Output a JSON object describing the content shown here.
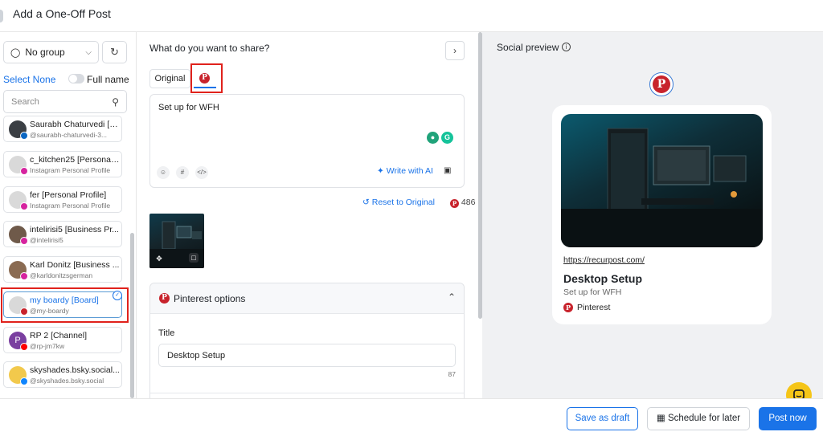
{
  "header": {
    "title": "Add a One-Off Post"
  },
  "sidebar": {
    "group_label": "No group",
    "select_none": "Select None",
    "full_name_label": "Full name",
    "search_placeholder": "Search",
    "accounts": [
      {
        "name": "Saurabh Chaturvedi [P...",
        "sub": "@saurabh-chaturvedi-3...",
        "network": "linkedin",
        "avatar_color": "#3b3f44"
      },
      {
        "name": "c_kitchen25 [Personal ...",
        "sub": "Instagram Personal Profile",
        "network": "instagram",
        "avatar_color": "#dcdcdc"
      },
      {
        "name": "fer [Personal Profile]",
        "sub": "Instagram Personal Profile",
        "network": "instagram",
        "avatar_color": "#dcdcdc"
      },
      {
        "name": "intelirisi5 [Business Pr...",
        "sub": "@intelirisi5",
        "network": "instagram",
        "avatar_color": "#6f5a4a"
      },
      {
        "name": "Karl Donitz [Business ...",
        "sub": "@karldonitzsgerman",
        "network": "instagram",
        "avatar_color": "#8a6b52"
      },
      {
        "name": "my boardy [Board]",
        "sub": "@my-boardy",
        "network": "pinterest",
        "avatar_color": "#dcdcdc",
        "selected": true
      },
      {
        "name": "RP 2 [Channel]",
        "sub": "@rp-jm7kw",
        "network": "youtube",
        "avatar_color": "#7a3fa0",
        "avatar_letter": "P"
      },
      {
        "name": "skyshades.bsky.social...",
        "sub": "@skyshades.bsky.social",
        "network": "bluesky",
        "avatar_color": "#f2c94c"
      }
    ]
  },
  "composer": {
    "question": "What do you want to share?",
    "tab_original": "Original",
    "text": "Set up for WFH",
    "write_ai": "Write with AI",
    "reset_label": "Reset to Original",
    "char_count": "486",
    "pinterest_options_label": "Pinterest options",
    "title_label": "Title",
    "title_value": "Desktop Setup",
    "title_count": "87"
  },
  "preview": {
    "label": "Social preview",
    "url": "https://recurpost.com/",
    "title": "Desktop Setup",
    "description": "Set up for WFH",
    "source": "Pinterest"
  },
  "footer": {
    "save_draft": "Save as draft",
    "schedule_later": "Schedule for later",
    "post_now": "Post now"
  },
  "colors": {
    "accent": "#1a73e8",
    "pinterest": "#c8232c",
    "highlight": "#e0221c"
  },
  "icons": [
    "user-group-icon",
    "chevron-down-icon",
    "refresh-icon",
    "search-icon",
    "chevron-right-icon",
    "pinterest-icon",
    "emoji-icon",
    "hashtag-icon",
    "code-icon",
    "sparkle-icon",
    "reset-icon",
    "move-icon",
    "comment-icon",
    "chevron-up-icon",
    "info-icon",
    "calendar-icon",
    "chat-icon",
    "check-icon"
  ]
}
